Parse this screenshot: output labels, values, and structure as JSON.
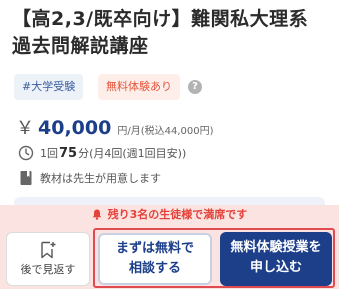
{
  "course": {
    "title_line1": "【高2,3/既卒向け】難関私大理系",
    "title_line2": "過去問解説講座"
  },
  "tags": {
    "subject": "#大学受験",
    "trial": "無料体験あり"
  },
  "price": {
    "currency": "￥",
    "amount": "40,000",
    "unit": "円/月(税込44,000円)"
  },
  "lesson": {
    "prefix": "1回",
    "minutes": "75",
    "suffix": "分(月4回(週1回目安))"
  },
  "material": {
    "text": "教材は先生が用意します"
  },
  "notice": {
    "text": "残り3名の生徒様で満席です"
  },
  "actions": {
    "later_label": "後で見返す",
    "consult_line1": "まずは無料で",
    "consult_line2": "相談する",
    "apply_line1": "無料体験授業を",
    "apply_line2": "申し込む"
  },
  "colors": {
    "accent": "#1d3f8a",
    "alert": "#e3433a",
    "bar_bg": "#fbe3e1",
    "highlight_frame": "#e04b52"
  }
}
